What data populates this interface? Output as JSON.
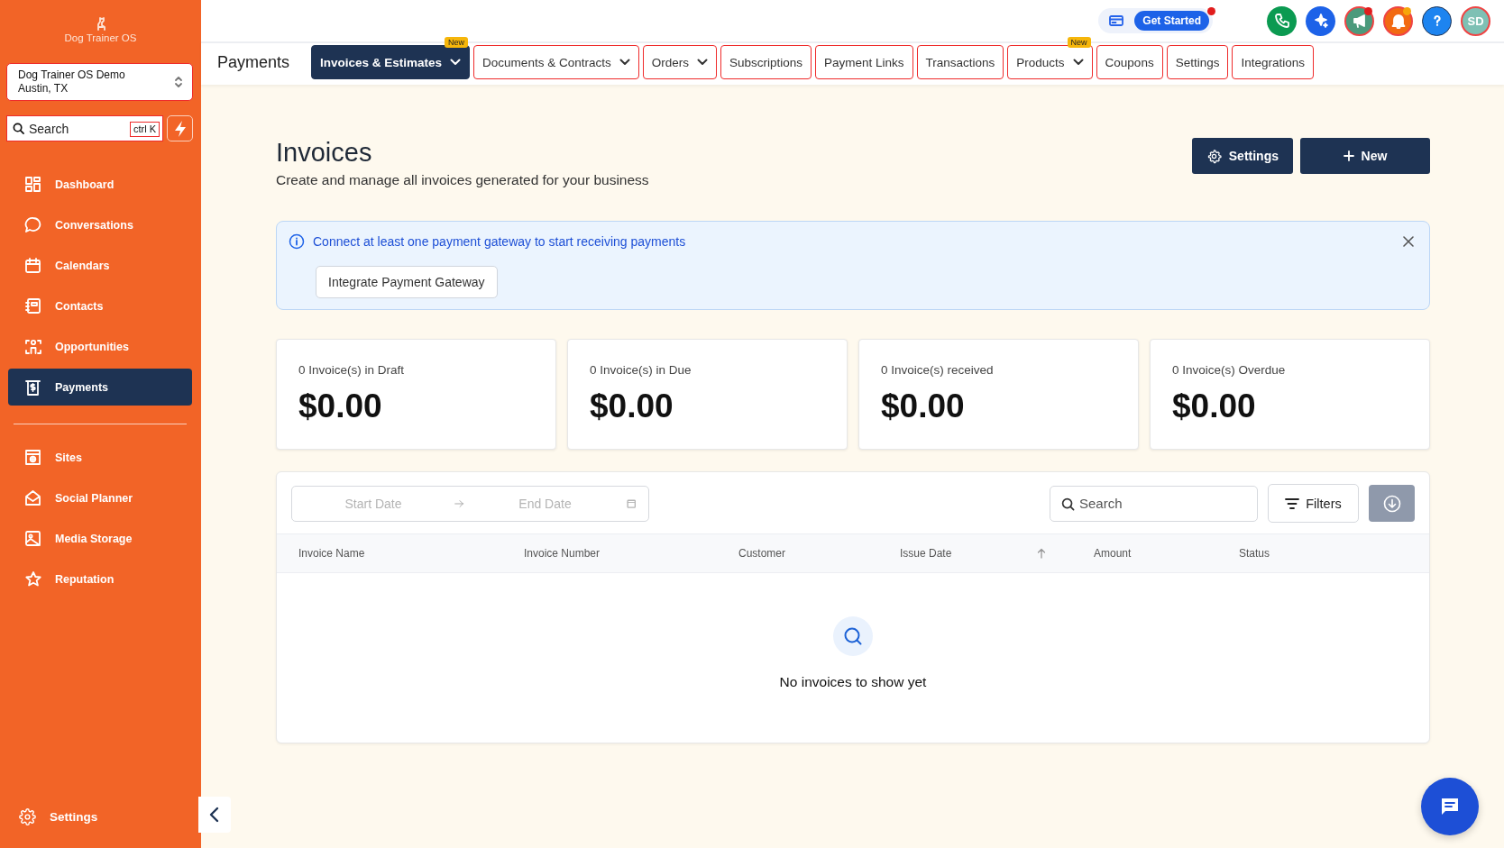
{
  "sidebar": {
    "logo": "Dog Trainer OS",
    "account": {
      "name": "Dog Trainer OS Demo",
      "location": "Austin, TX"
    },
    "search": {
      "placeholder": "Search",
      "shortcut": "ctrl K"
    },
    "items": [
      {
        "label": "Dashboard",
        "selected": false
      },
      {
        "label": "Conversations",
        "selected": false
      },
      {
        "label": "Calendars",
        "selected": false
      },
      {
        "label": "Contacts",
        "selected": false
      },
      {
        "label": "Opportunities",
        "selected": false
      },
      {
        "label": "Payments",
        "selected": true
      }
    ],
    "items_2": [
      {
        "label": "Sites",
        "selected": false
      },
      {
        "label": "Social Planner",
        "selected": false
      },
      {
        "label": "Media Storage",
        "selected": false
      },
      {
        "label": "Reputation",
        "selected": false
      }
    ],
    "footer": {
      "label": "Settings"
    }
  },
  "header": {
    "get_started": {
      "label": "Get Started",
      "notification": true
    },
    "icons": [
      {
        "notification": false
      },
      {
        "notification": false
      },
      {
        "notification": true
      },
      {
        "notification": true
      }
    ],
    "avatar": "SD"
  },
  "tab_bar": {
    "title": "Payments",
    "tabs": [
      {
        "label": "Invoices & Estimates",
        "selected": true,
        "dropdown": true,
        "badge": "New"
      },
      {
        "label": "Documents & Contracts",
        "selected": false,
        "dropdown": true
      },
      {
        "label": "Orders",
        "selected": false,
        "dropdown": true
      },
      {
        "label": "Subscriptions",
        "selected": false,
        "dropdown": false
      },
      {
        "label": "Payment Links",
        "selected": false,
        "dropdown": false
      },
      {
        "label": "Transactions",
        "selected": false,
        "dropdown": false
      },
      {
        "label": "Products",
        "selected": false,
        "dropdown": true,
        "badge": "New"
      },
      {
        "label": "Coupons",
        "selected": false,
        "dropdown": false
      },
      {
        "label": "Settings",
        "selected": false,
        "dropdown": false
      },
      {
        "label": "Integrations",
        "selected": false,
        "dropdown": false
      }
    ]
  },
  "page": {
    "title": "Invoices",
    "subtitle": "Create and manage all invoices generated for your business",
    "buttons": {
      "settings": "Settings",
      "new": "New"
    }
  },
  "alert": {
    "message": "Connect at least one payment gateway to start receiving payments",
    "button": "Integrate Payment Gateway"
  },
  "stats": [
    {
      "label": "0 Invoice(s) in Draft",
      "value": "$0.00"
    },
    {
      "label": "0 Invoice(s) in Due",
      "value": "$0.00"
    },
    {
      "label": "0 Invoice(s) received",
      "value": "$0.00"
    },
    {
      "label": "0 Invoice(s) Overdue",
      "value": "$0.00"
    }
  ],
  "table": {
    "start_date": {
      "placeholder": "Start Date"
    },
    "end_date": {
      "placeholder": "End Date"
    },
    "search": {
      "placeholder": "Search"
    },
    "filters": "Filters",
    "columns": [
      {
        "label": "Invoice Name",
        "sorted": false
      },
      {
        "label": "Invoice Number",
        "sorted": false
      },
      {
        "label": "Customer",
        "sorted": false
      },
      {
        "label": "Issue Date",
        "sorted": true
      },
      {
        "label": "Amount",
        "sorted": false
      },
      {
        "label": "Status",
        "sorted": false
      }
    ],
    "empty": "No invoices to show yet"
  }
}
